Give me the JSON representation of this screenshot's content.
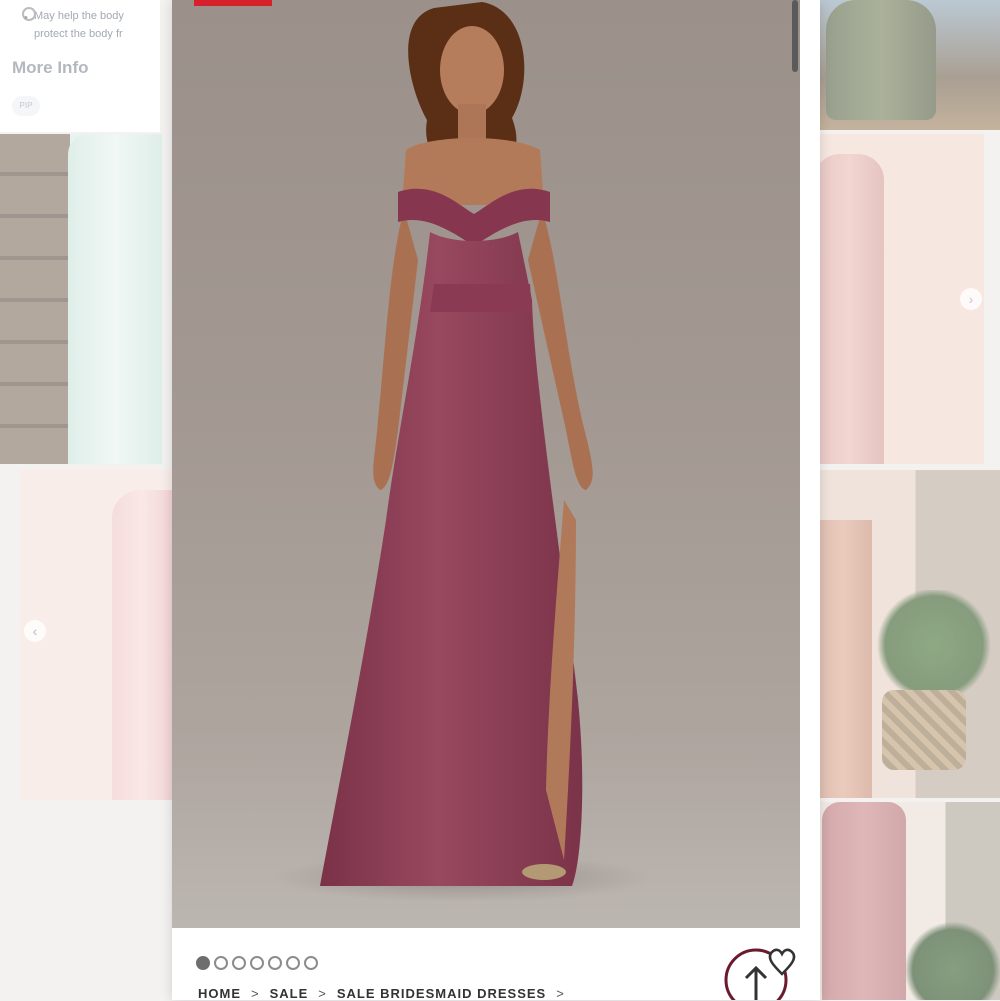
{
  "info_panel": {
    "bullet_line1": "May help the body",
    "bullet_line2": "protect the body fr",
    "more_info_label": "More Info",
    "tag_label": "PIP"
  },
  "carousel": {
    "slide_count": 7,
    "active_index": 0,
    "prev_icon": "chevron-left-icon",
    "next_icon": "chevron-right-icon"
  },
  "breadcrumb": {
    "items": [
      "HOME",
      "SALE",
      "SALE BRIDESMAID DRESSES"
    ],
    "separator": ">"
  },
  "colors": {
    "dress": "#8e3f5a",
    "sale_tag": "#d6202b",
    "accent": "#6b1a2e"
  },
  "icons": {
    "favorite": "heart-icon",
    "scroll_top": "arrow-up-circle-icon"
  }
}
